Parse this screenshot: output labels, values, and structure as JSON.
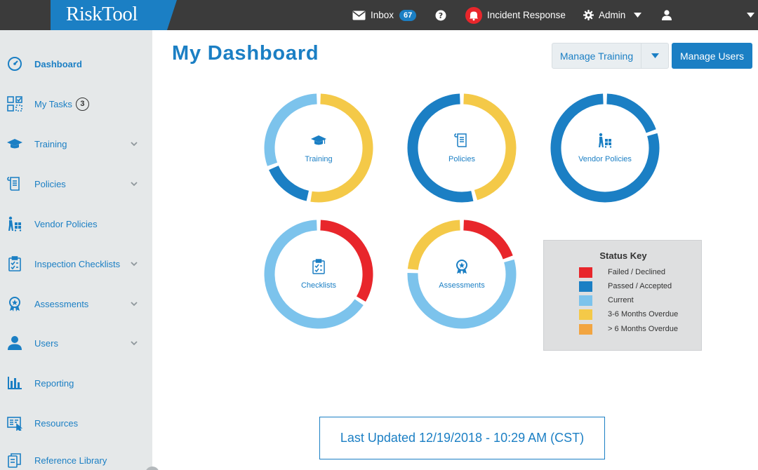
{
  "app": {
    "logo_text": "RiskTool"
  },
  "topbar": {
    "inbox_label": "Inbox",
    "inbox_count": "67",
    "help_icon": "question-circle-icon",
    "incident_label": "Incident Response",
    "admin_label": "Admin"
  },
  "sidebar": {
    "items": [
      {
        "label": "Dashboard",
        "icon": "gauge-icon",
        "active": true
      },
      {
        "label": "My Tasks",
        "icon": "tasks-grid-icon",
        "count": "3"
      },
      {
        "label": "Training",
        "icon": "graduation-cap-icon",
        "expandable": true
      },
      {
        "label": "Policies",
        "icon": "scroll-icon",
        "expandable": true
      },
      {
        "label": "Vendor Policies",
        "icon": "vendor-cart-icon"
      },
      {
        "label": "Inspection Checklists",
        "icon": "clipboard-check-icon",
        "expandable": true
      },
      {
        "label": "Assessments",
        "icon": "award-ribbon-icon",
        "expandable": true
      },
      {
        "label": "Users",
        "icon": "user-icon",
        "expandable": true
      },
      {
        "label": "Reporting",
        "icon": "bar-chart-icon"
      },
      {
        "label": "Resources",
        "icon": "resources-icon"
      },
      {
        "label": "Reference Library",
        "icon": "library-icon"
      }
    ]
  },
  "main": {
    "title": "My Dashboard",
    "manage_training_label": "Manage Training",
    "manage_users_label": "Manage Users",
    "last_updated": "Last Updated 12/19/2018 - 10:29 AM (CST)"
  },
  "colors": {
    "failed": "#e8262b",
    "passed": "#1b7fc4",
    "current": "#7cc3ec",
    "overdue_3_6": "#f4c948",
    "overdue_6_plus": "#f2a541",
    "brand": "#1b7fc4"
  },
  "donuts": [
    {
      "label": "Training",
      "icon": "graduation-cap-icon",
      "segments": [
        {
          "status": "overdue_3_6",
          "share": 0.53
        },
        {
          "status": "passed",
          "share": 0.16
        },
        {
          "status": "current",
          "share": 0.31
        }
      ]
    },
    {
      "label": "Policies",
      "icon": "scroll-icon",
      "segments": [
        {
          "status": "overdue_3_6",
          "share": 0.46
        },
        {
          "status": "passed",
          "share": 0.54
        }
      ]
    },
    {
      "label": "Vendor Policies",
      "icon": "vendor-cart-icon",
      "segments": [
        {
          "status": "passed",
          "share": 0.2
        },
        {
          "status": "passed",
          "share": 0.8
        }
      ]
    },
    {
      "label": "Checklists",
      "icon": "clipboard-check-icon",
      "segments": [
        {
          "status": "failed",
          "share": 0.34
        },
        {
          "status": "current",
          "share": 0.66
        }
      ]
    },
    {
      "label": "Assessments",
      "icon": "award-ribbon-icon",
      "segments": [
        {
          "status": "failed",
          "share": 0.2
        },
        {
          "status": "current",
          "share": 0.56
        },
        {
          "status": "overdue_3_6",
          "share": 0.24
        }
      ]
    }
  ],
  "status_key": {
    "title": "Status Key",
    "entries": [
      {
        "label": "Failed / Declined",
        "color": "#e8262b"
      },
      {
        "label": "Passed / Accepted",
        "color": "#1b7fc4"
      },
      {
        "label": "Current",
        "color": "#7cc3ec"
      },
      {
        "label": "3-6 Months Overdue",
        "color": "#f4c948"
      },
      {
        "label": "> 6 Months Overdue",
        "color": "#f2a541"
      }
    ]
  }
}
